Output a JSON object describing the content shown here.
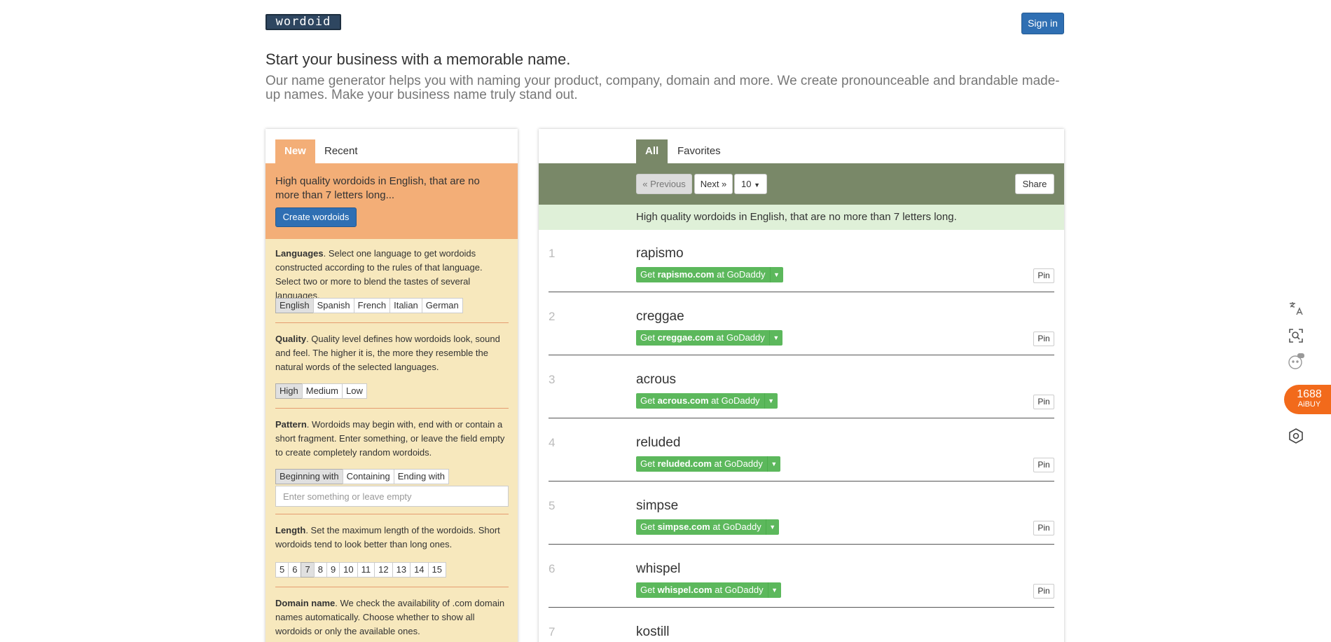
{
  "header": {
    "logo": "wordoid",
    "signin": "Sign in"
  },
  "hero": {
    "title": "Start your business with a memorable name.",
    "lead": "Our name generator helps you with naming your product, company, domain and more. We create pronounceable and brandable made-up names. Make your business name truly stand out."
  },
  "left": {
    "tabs": [
      "New",
      "Recent"
    ],
    "summary": "High quality wordoids in English, that are no more than 7 letters long...",
    "create": "Create wordoids",
    "languages": {
      "title": "Languages",
      "desc": ". Select one language to get wordoids constructed according to the rules of that language. Select two or more to blend the tastes of several languages.",
      "options": [
        "English",
        "Spanish",
        "French",
        "Italian",
        "German"
      ]
    },
    "quality": {
      "title": "Quality",
      "desc": ". Quality level defines how wordoids look, sound and feel. The higher it is, the more they resemble the natural words of the selected languages.",
      "options": [
        "High",
        "Medium",
        "Low"
      ]
    },
    "pattern": {
      "title": "Pattern",
      "desc": ". Wordoids may begin with, end with or contain a short fragment. Enter something, or leave the field empty to create completely random wordoids.",
      "options": [
        "Beginning with",
        "Containing",
        "Ending with"
      ],
      "placeholder": "Enter something or leave empty"
    },
    "length": {
      "title": "Length",
      "desc": ". Set the maximum length of the wordoids. Short wordoids tend to look better than long ones.",
      "options": [
        "5",
        "6",
        "7",
        "8",
        "9",
        "10",
        "11",
        "12",
        "13",
        "14",
        "15"
      ]
    },
    "domain": {
      "title": "Domain name",
      "desc": ". We check the availability of .com domain names automatically. Choose whether to show all wordoids or only the available ones."
    }
  },
  "right": {
    "tabs": [
      "All",
      "Favorites"
    ],
    "prev": "« Previous",
    "next": "Next »",
    "count": "10",
    "share": "Share",
    "banner": "High quality wordoids in English, that are no more than 7 letters long.",
    "pin": "Pin",
    "get_prefix": "Get ",
    "get_suffix": " at GoDaddy",
    "results": [
      {
        "num": "1",
        "word": "rapismo",
        "domain": "rapismo.com"
      },
      {
        "num": "2",
        "word": "creggae",
        "domain": "creggae.com"
      },
      {
        "num": "3",
        "word": "acrous",
        "domain": "acrous.com"
      },
      {
        "num": "4",
        "word": "reluded",
        "domain": "reluded.com"
      },
      {
        "num": "5",
        "word": "simpse",
        "domain": "simpse.com"
      },
      {
        "num": "6",
        "word": "whispel",
        "domain": "whispel.com"
      },
      {
        "num": "7",
        "word": "kostill",
        "domain": ""
      }
    ]
  },
  "sidebar": {
    "aibuy_top": "1688",
    "aibuy_bottom": "AiBUY",
    "icons": [
      "translate-icon",
      "scan-search-icon",
      "ai-assistant-icon",
      "settings-hex-icon"
    ]
  },
  "colors": {
    "accent_orange": "#f3ae77",
    "olive": "#798868",
    "primary_blue": "#2f6fb3",
    "godaddy_green": "#5cb85c",
    "aibuy_orange": "#f26a1b"
  }
}
